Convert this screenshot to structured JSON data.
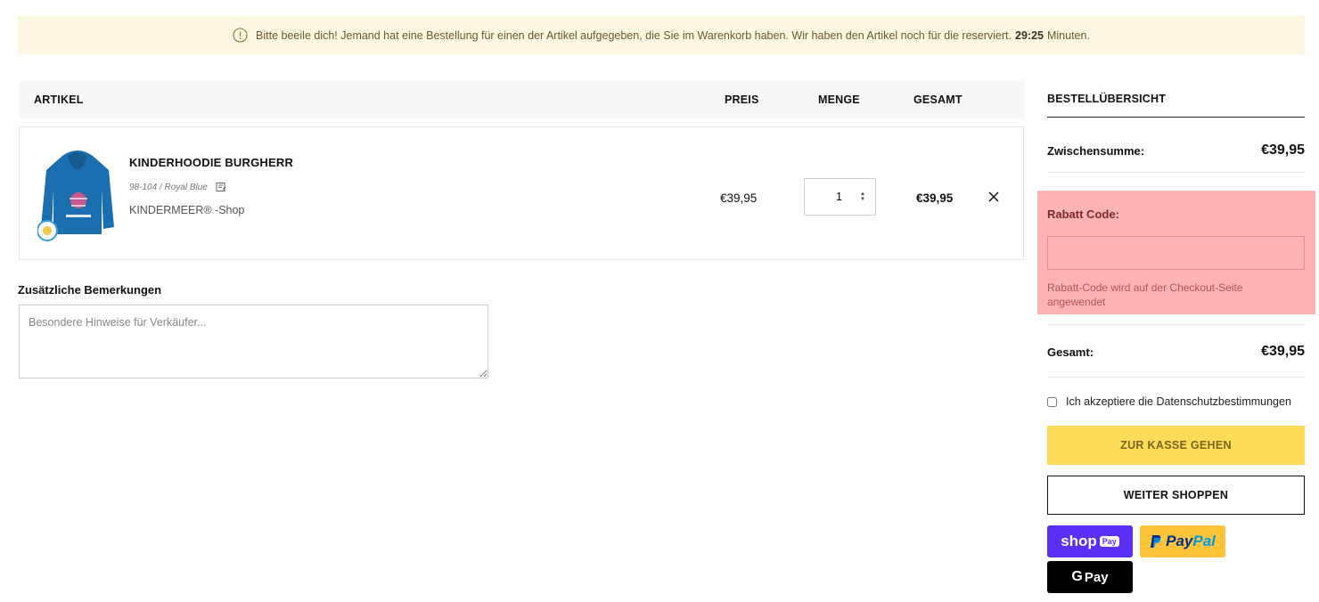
{
  "notice": {
    "text": "Bitte beeile dich! Jemand hat eine Bestellung für einen der Artikel aufgegeben, die Sie im Warenkorb haben. Wir haben den Artikel noch für die reserviert.",
    "timer": "29:25",
    "suffix": "Minuten."
  },
  "table": {
    "headers": {
      "artikel": "ARTIKEL",
      "preis": "PREIS",
      "menge": "MENGE",
      "gesamt": "GESAMT"
    }
  },
  "item": {
    "name": "KINDERHOODIE BURGHERR",
    "variant": "98-104 / Royal Blue",
    "vendor": "KINDERMEER® -Shop",
    "price": "€39,95",
    "quantity": "1",
    "total": "€39,95",
    "hoodie_color": "#1b6fb0"
  },
  "notes": {
    "label": "Zusätzliche Bemerkungen",
    "placeholder": "Besondere Hinweise für Verkäufer..."
  },
  "summary": {
    "title": "BESTELLÜBERSICHT",
    "subtotal_label": "Zwischensumme:",
    "subtotal_value": "€39,95",
    "discount_label": "Rabatt Code:",
    "discount_value": "",
    "discount_hint": "Rabatt-Code wird auf der Checkout-Seite angewendet",
    "total_label": "Gesamt:",
    "total_value": "€39,95",
    "privacy_label": "Ich akzeptiere die Datenschutzbestimmungen",
    "checkout_label": "ZUR KASSE GEHEN",
    "continue_label": "WEITER SHOPPEN"
  },
  "payment": {
    "shop_pay_text": "shop",
    "shop_pay_chip": "Pay",
    "paypal_text_1": "Pay",
    "paypal_text_2": "Pal",
    "gpay_g": "G",
    "gpay_text": "Pay"
  },
  "colors": {
    "notice_bg": "#fbf7e3",
    "checkout_bg": "#fddc57",
    "highlight": "#ffb3b3",
    "shop_pay": "#5a31f4",
    "paypal": "#ffc439"
  }
}
